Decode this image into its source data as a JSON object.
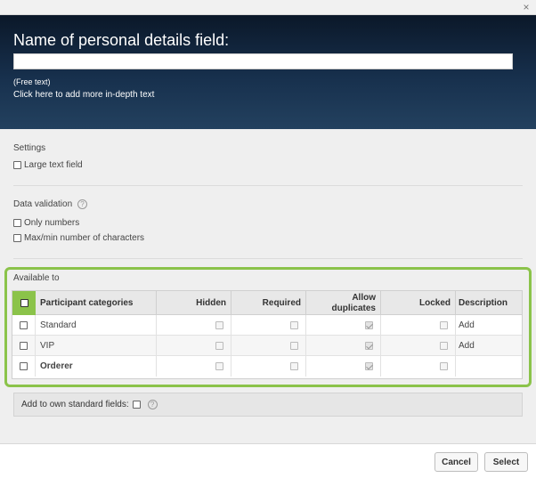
{
  "dialog": {
    "close_glyph": "×"
  },
  "header": {
    "title": "Name of personal details field:",
    "title_value": "",
    "free_text": "(Free text)",
    "add_text_link": "Click here to add more in-depth text"
  },
  "settings": {
    "heading": "Settings",
    "large_text_field": {
      "label": "Large text field",
      "checked": false
    }
  },
  "validation": {
    "heading": "Data validation",
    "help_glyph": "?",
    "only_numbers": {
      "label": "Only numbers",
      "checked": false
    },
    "maxmin": {
      "label": "Max/min number of characters",
      "checked": false
    }
  },
  "available": {
    "heading": "Available to",
    "accent_color": "#8bc34a",
    "columns": [
      "Participant categories",
      "Hidden",
      "Required",
      "Allow duplicates",
      "Locked",
      "Description"
    ],
    "rows": [
      {
        "name": "Standard",
        "hidden": false,
        "required": false,
        "allow_duplicates": true,
        "locked": false,
        "description": "Add"
      },
      {
        "name": "VIP",
        "hidden": false,
        "required": false,
        "allow_duplicates": true,
        "locked": false,
        "description": "Add"
      },
      {
        "name": "Orderer",
        "hidden": false,
        "required": false,
        "allow_duplicates": true,
        "locked": false,
        "description": ""
      }
    ]
  },
  "standard_fields": {
    "label": "Add to own standard fields:",
    "help_glyph": "?"
  },
  "footer": {
    "cancel_label": "Cancel",
    "select_label": "Select"
  }
}
